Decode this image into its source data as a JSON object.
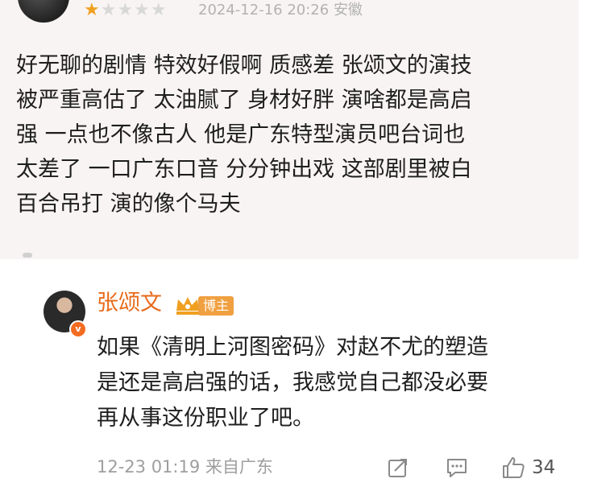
{
  "review": {
    "rating": 1,
    "max_rating": 5,
    "timestamp": "2024-12-16 20:26",
    "location": "安徽",
    "lines": [
      "好无聊的剧情 特效好假啊 质感差 张颂文的演技",
      "被严重高估了 太油腻了 身材好胖 演啥都是高启",
      "强 一点也不像古人 他是广东特型演员吧台词也",
      "太差了 一口广东口音 分分钟出戏 这部剧里被白",
      "百合吊打 演的像个马夫"
    ]
  },
  "reply": {
    "author": "张颂文",
    "badge": "博主",
    "verify_mark": "v",
    "lines": [
      "如果《清明上河图密码》对赵不尤的塑造",
      "是还是高启强的话，我感觉自己都没必要",
      "再从事这份职业了吧。"
    ],
    "date": "12-23 01:19",
    "location": "来自广东",
    "like_count": "34"
  },
  "colors": {
    "star_on": "#f0a020",
    "author_name": "#e86a19",
    "badge_bg": "#f0a040",
    "verify": "#f36c21"
  },
  "icons": [
    "star-icon",
    "crown-icon",
    "share-icon",
    "comment-icon",
    "like-icon"
  ]
}
